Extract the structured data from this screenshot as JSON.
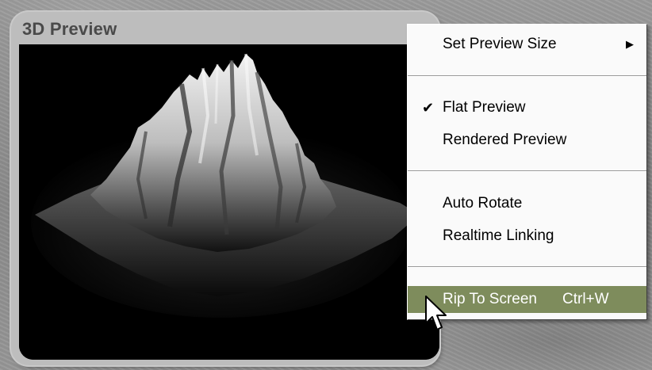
{
  "window": {
    "title": "3D Preview"
  },
  "context_menu": {
    "items": [
      {
        "label": "Set Preview Size",
        "has_submenu": true,
        "checked": false,
        "shortcut": ""
      },
      {
        "label": "Flat Preview",
        "has_submenu": false,
        "checked": true,
        "shortcut": ""
      },
      {
        "label": "Rendered Preview",
        "has_submenu": false,
        "checked": false,
        "shortcut": ""
      },
      {
        "label": "Auto Rotate",
        "has_submenu": false,
        "checked": false,
        "shortcut": ""
      },
      {
        "label": "Realtime Linking",
        "has_submenu": false,
        "checked": false,
        "shortcut": ""
      },
      {
        "label": "Rip To Screen",
        "has_submenu": false,
        "checked": false,
        "shortcut": "Ctrl+W",
        "highlighted": true
      }
    ],
    "check_glyph": "✔",
    "submenu_glyph": "▶",
    "highlight_color": "#7e8c5c"
  },
  "icons": {
    "cursor": "mouse-pointer-icon",
    "check": "checkmark-icon",
    "submenu": "submenu-arrow-icon"
  }
}
